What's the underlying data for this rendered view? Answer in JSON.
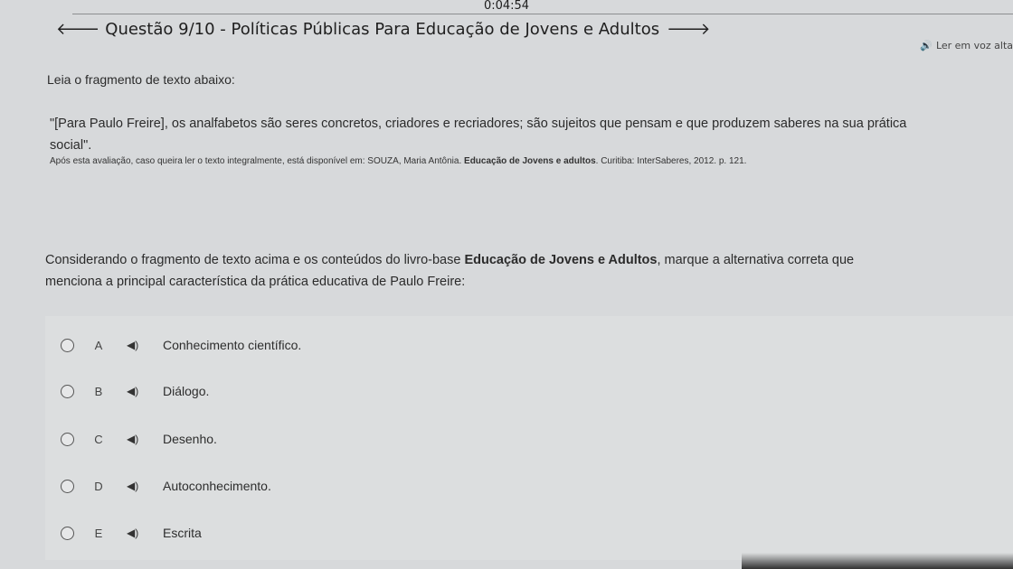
{
  "timer": "0:04:54",
  "header": {
    "back_arrow": "arrow-left-icon",
    "title": "Questão 9/10 - Políticas Públicas Para Educação de Jovens e Adultos",
    "forward_arrow": "arrow-right-icon"
  },
  "read_aloud": {
    "icon": "speaker-icon",
    "label": "Ler em voz alta"
  },
  "prompt": "Leia o fragmento de texto abaixo:",
  "quote": {
    "line1": "\"[Para Paulo Freire], os analfabetos são seres concretos, criadores e recriadores; são sujeitos que pensam e que produzem saberes na sua prática",
    "line2": "social\"."
  },
  "reference": {
    "prefix": "Após esta avaliação, caso queira ler o texto integralmente, está disponível em: SOUZA, Maria Antônia. ",
    "book": "Educação de Jovens e adultos",
    "suffix": ". Curitiba: InterSaberes, 2012. p. 121."
  },
  "statement": {
    "part1": "Considerando o fragmento de texto acima e os conteúdos do livro-base ",
    "bold": "Educação de Jovens e Adultos",
    "part2": ", marque a alternativa correta que",
    "line2": "menciona a principal característica da prática educativa de Paulo Freire:"
  },
  "options": [
    {
      "letter": "A",
      "text": "Conhecimento científico."
    },
    {
      "letter": "B",
      "text": "Diálogo."
    },
    {
      "letter": "C",
      "text": "Desenho."
    },
    {
      "letter": "D",
      "text": "Autoconhecimento."
    },
    {
      "letter": "E",
      "text": "Escrita"
    }
  ],
  "speaker_glyph": "◀)"
}
